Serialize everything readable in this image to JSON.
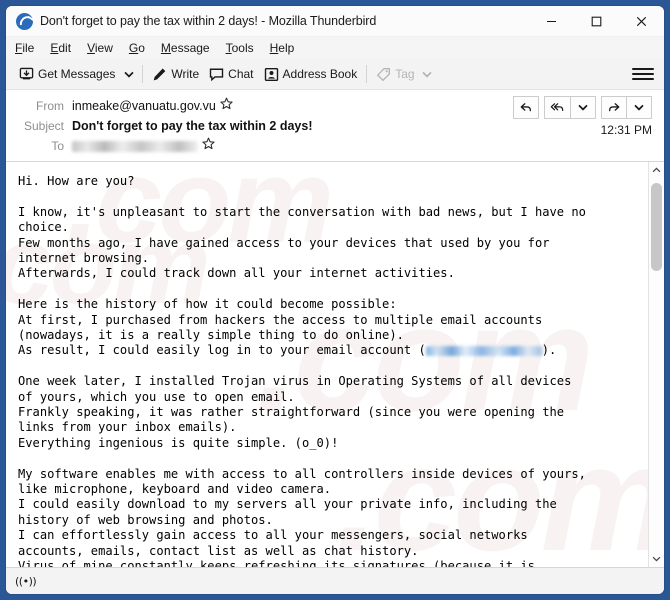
{
  "window": {
    "title": "Don't forget to pay the tax within 2 days! - Mozilla Thunderbird",
    "logo_icon": "thunderbird-icon",
    "controls": {
      "minimize": "minimize-icon",
      "maximize": "maximize-icon",
      "close": "close-icon"
    }
  },
  "menu": {
    "items": [
      {
        "label": "File",
        "mnemonic": "F"
      },
      {
        "label": "Edit",
        "mnemonic": "E"
      },
      {
        "label": "View",
        "mnemonic": "V"
      },
      {
        "label": "Go",
        "mnemonic": "G"
      },
      {
        "label": "Message",
        "mnemonic": "M"
      },
      {
        "label": "Tools",
        "mnemonic": "T"
      },
      {
        "label": "Help",
        "mnemonic": "H"
      }
    ]
  },
  "toolbar": {
    "get_messages": "Get Messages",
    "get_messages_icon": "download-inbox-icon",
    "get_messages_caret": "chevron-down-icon",
    "write": "Write",
    "write_icon": "pencil-icon",
    "chat": "Chat",
    "chat_icon": "speech-bubble-icon",
    "address_book": "Address Book",
    "address_book_icon": "contact-card-icon",
    "tag": "Tag",
    "tag_icon": "tag-icon",
    "tag_caret": "chevron-down-icon",
    "tag_disabled": true,
    "app_menu_icon": "hamburger-icon"
  },
  "message_header": {
    "from_label": "From",
    "from_value": "inmeake@vanuatu.gov.vu",
    "from_star_icon": "star-outline-icon",
    "subject_label": "Subject",
    "subject_value": "Don't forget to pay the tax within 2 days!",
    "to_label": "To",
    "to_value": "",
    "to_redacted": true,
    "to_star_icon": "star-outline-icon",
    "time": "12:31 PM",
    "actions": [
      {
        "name": "reply-button",
        "icon": "reply-arrow-icon"
      },
      {
        "name": "reply-all-button",
        "icon": "reply-all-arrow-icon"
      },
      {
        "name": "reply-menu-button",
        "icon": "chevron-down-icon"
      },
      {
        "name": "forward-button",
        "icon": "forward-arrow-icon"
      },
      {
        "name": "more-actions-button",
        "icon": "chevron-down-icon"
      }
    ]
  },
  "message_body": {
    "lines": [
      "Hi. How are you?",
      "",
      "I know, it's unpleasant to start the conversation with bad news, but I have no choice.",
      "Few months ago, I have gained access to your devices that used by you for internet browsing.",
      "Afterwards, I could track down all your internet activities.",
      "",
      "Here is the history of how it could become possible:",
      "At first, I purchased from hackers the access to multiple email accounts (nowadays, it is a really simple thing to do online).",
      "__REDACTED_EMAIL_LINE__",
      "",
      "One week later, I installed Trojan virus in Operating Systems of all devices of yours, which you use to open email.",
      "Frankly speaking, it was rather straightforward (since you were opening the links from your inbox emails).",
      "Everything ingenious is quite simple. (o_0)!",
      "",
      "My software enables me with access to all controllers inside devices of yours, like microphone, keyboard and video camera.",
      "I could easily download to my servers all your private info, including the history of web browsing and photos.",
      "I can effortlessly gain access to all your messengers, social networks accounts, emails, contact list as well as chat history.",
      "Virus of mine constantly keeps refreshing its signatures (because it is driver-based), and as result remains unnoticed by your antivirus."
    ],
    "redacted_line_prefix": "As result, I could easily log in to your email account (",
    "redacted_line_suffix": ").",
    "watermark_text": ".com"
  },
  "scrollbar": {
    "up_arrow_icon": "chevron-up-icon",
    "down_arrow_icon": "chevron-down-icon",
    "thumb": "scroll-thumb"
  },
  "status_bar": {
    "connection_icon": "((•))"
  },
  "colors": {
    "window_border": "#2b5797",
    "accent": "#2c6bb9",
    "toolbar_bg": "#f3f3f3",
    "body_bg": "#ffffff",
    "label_gray": "#8e8e8e"
  }
}
